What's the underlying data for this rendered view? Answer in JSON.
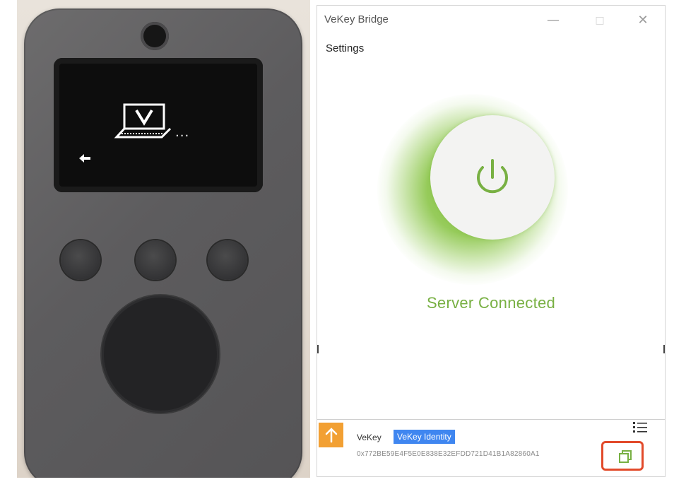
{
  "window": {
    "title": "VeKey Bridge",
    "minimize_icon": "minimize-icon",
    "maximize_icon": "maximize-icon",
    "close_icon": "close-icon",
    "menu": {
      "settings_label": "Settings"
    }
  },
  "main": {
    "power_icon": "power-icon",
    "status_text": "Server Connected",
    "accent_color": "#78b043"
  },
  "footer": {
    "upload_icon": "arrow-up-icon",
    "upload_color": "#f2a033",
    "device_name": "VeKey",
    "identity_badge": "VeKey Identity",
    "badge_color": "#3f86f0",
    "address": "0x772BE59E4F5E0E838E32EFDD721D41B1A82860A1",
    "menu_icon": "list-menu-icon",
    "copy_icon": "copy-icon",
    "highlight_color": "#e24a2a"
  },
  "device_photo": {
    "screen_icon": "laptop-v-icon",
    "screen_text": "...",
    "back_icon": "arrow-left-icon"
  }
}
